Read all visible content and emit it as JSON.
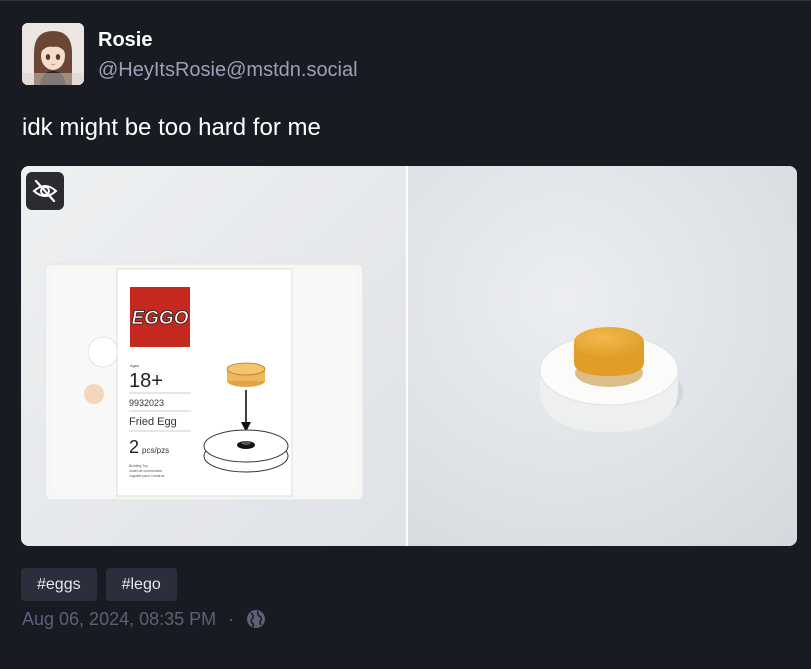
{
  "post": {
    "author": {
      "display_name": "Rosie",
      "handle": "@HeyItsRosie@mstdn.social",
      "avatar_icon": "avatar-anime-girl"
    },
    "text": "idk might be too hard for me",
    "media": {
      "hide_icon": "eye-slash-icon",
      "left_image": {
        "brand": "EGGO",
        "age_small": "Ages",
        "age": "18+",
        "set_number": "9932023",
        "set_name": "Fried Egg",
        "count": "2",
        "count_unit": "pcs/pzs",
        "fine_print": [
          "Building Toy",
          "Jouet de construction",
          "Juguete para Construir"
        ]
      },
      "right_image": {}
    },
    "tags": [
      "#eggs",
      "#lego"
    ],
    "timestamp": "Aug 06, 2024, 08:35 PM",
    "separator": "·",
    "visibility_icon": "globe-icon"
  },
  "colors": {
    "background": "#191b22",
    "secondary_text": "#9ba0b8",
    "meta_text": "#5c6178",
    "tag_bg": "#2c2f3b"
  }
}
